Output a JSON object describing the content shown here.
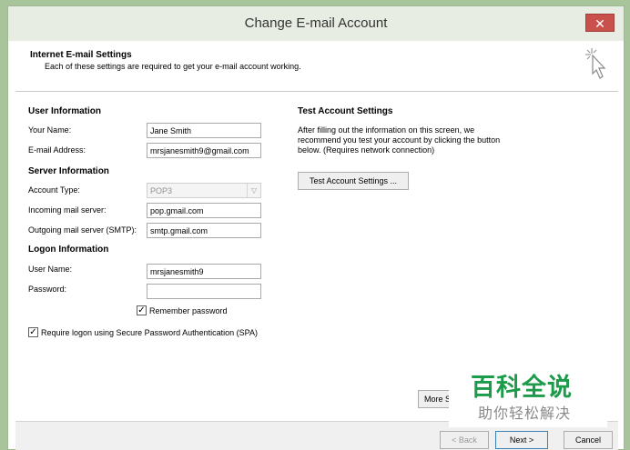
{
  "window": {
    "title": "Change E-mail Account",
    "close_label": "✕"
  },
  "header": {
    "title": "Internet E-mail Settings",
    "subtitle": "Each of these settings are required to get your e-mail account working."
  },
  "user_info": {
    "section": "User Information",
    "name_label": "Your Name:",
    "name_value": "Jane Smith",
    "email_label": "E-mail Address:",
    "email_value": "mrsjanesmith9@gmail.com"
  },
  "server_info": {
    "section": "Server Information",
    "account_type_label": "Account Type:",
    "account_type_value": "POP3",
    "incoming_label": "Incoming mail server:",
    "incoming_value": "pop.gmail.com",
    "outgoing_label": "Outgoing mail server (SMTP):",
    "outgoing_value": "smtp.gmail.com"
  },
  "logon_info": {
    "section": "Logon Information",
    "username_label": "User Name:",
    "username_value": "mrsjanesmith9",
    "password_label": "Password:",
    "password_value": "",
    "remember_label": "Remember password",
    "remember_checked": true,
    "spa_label": "Require logon using Secure Password Authentication (SPA)",
    "spa_checked": true
  },
  "test": {
    "section": "Test Account Settings",
    "description": "After filling out the information on this screen, we recommend you test your account by clicking the button below. (Requires network connection)",
    "button_label": "Test Account Settings ..."
  },
  "more_settings_label": "More Set",
  "footer": {
    "back_label": "< Back",
    "next_label": "Next >",
    "cancel_label": "Cancel"
  },
  "watermark": {
    "main": "百科全说",
    "sub": "助你轻松解决"
  },
  "colors": {
    "background": "#a7c49a",
    "close": "#c9514b",
    "watermark": "#1c9b4a"
  }
}
